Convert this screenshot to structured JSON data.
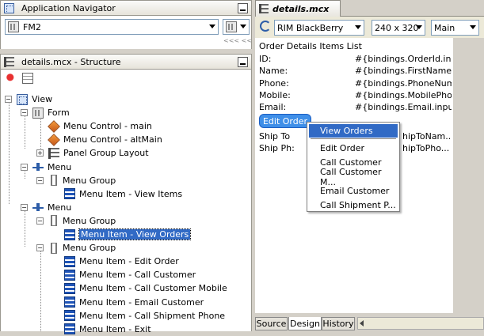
{
  "left_top_panel": {
    "title": "Application Navigator",
    "project_selector": "FM2",
    "nav_arrows": "<<< <<"
  },
  "structure_panel": {
    "title": "details.mcx - Structure",
    "tree": [
      {
        "label": "View",
        "icon": "view-icon",
        "level": 0
      },
      {
        "label": "Form",
        "icon": "form-icon",
        "level": 1
      },
      {
        "label": "Menu Control - main",
        "icon": "control-icon",
        "level": 2
      },
      {
        "label": "Menu Control - altMain",
        "icon": "control-icon",
        "level": 2
      },
      {
        "label": "Panel Group Layout",
        "icon": "panel-group-icon",
        "level": 2
      },
      {
        "label": "Menu",
        "icon": "menu-icon",
        "level": 1
      },
      {
        "label": "Menu Group",
        "icon": "group-icon",
        "level": 2
      },
      {
        "label": "Menu Item - View Items",
        "icon": "menu-item-icon",
        "level": 3
      },
      {
        "label": "Menu",
        "icon": "menu-icon",
        "level": 1
      },
      {
        "label": "Menu Group",
        "icon": "group-icon",
        "level": 2
      },
      {
        "label": "Menu Item - View Orders",
        "icon": "menu-item-icon",
        "level": 3
      },
      {
        "label": "Menu Group",
        "icon": "group-icon",
        "level": 2
      },
      {
        "label": "Menu Item - Edit Order",
        "icon": "menu-item-icon",
        "level": 3
      },
      {
        "label": "Menu Item - Call Customer",
        "icon": "menu-item-icon",
        "level": 3
      },
      {
        "label": "Menu Item - Call Customer Mobile",
        "icon": "menu-item-icon",
        "level": 3
      },
      {
        "label": "Menu Item - Email Customer",
        "icon": "menu-item-icon",
        "level": 3
      },
      {
        "label": "Menu Item - Call Shipment Phone",
        "icon": "menu-item-icon",
        "level": 3
      },
      {
        "label": "Menu Item - Exit",
        "icon": "menu-item-icon",
        "level": 3
      }
    ]
  },
  "editor": {
    "tab_title": "details.mcx",
    "device": "RIM BlackBerry",
    "resolution": "240 x 320",
    "view": "Main",
    "canvas": {
      "heading": "Order Details Items List",
      "fields": [
        {
          "label": "ID:",
          "value": "#{bindings.OrderId.inpu..."
        },
        {
          "label": "Name:",
          "value": "#{bindings.FirstName.in..."
        },
        {
          "label": "Phone:",
          "value": "#{bindings.PhoneNum..."
        },
        {
          "label": "Mobile:",
          "value": "#{bindings.MobilePhon..."
        },
        {
          "label": "Email:",
          "value": "#{bindings.Email.inputV..."
        }
      ],
      "edit_button": "Edit Order",
      "ship_to": {
        "label": "Ship To",
        "value": "hipToNam..."
      },
      "ship_ph": {
        "label": "Ship Ph:",
        "value": "hipToPho..."
      }
    },
    "context_menu": [
      "View Orders",
      "Edit Order",
      "Call Customer",
      "Call Customer M...",
      "Email Customer",
      "Call Shipment P..."
    ],
    "bottom_tabs": [
      "Source",
      "Design",
      "History"
    ]
  }
}
